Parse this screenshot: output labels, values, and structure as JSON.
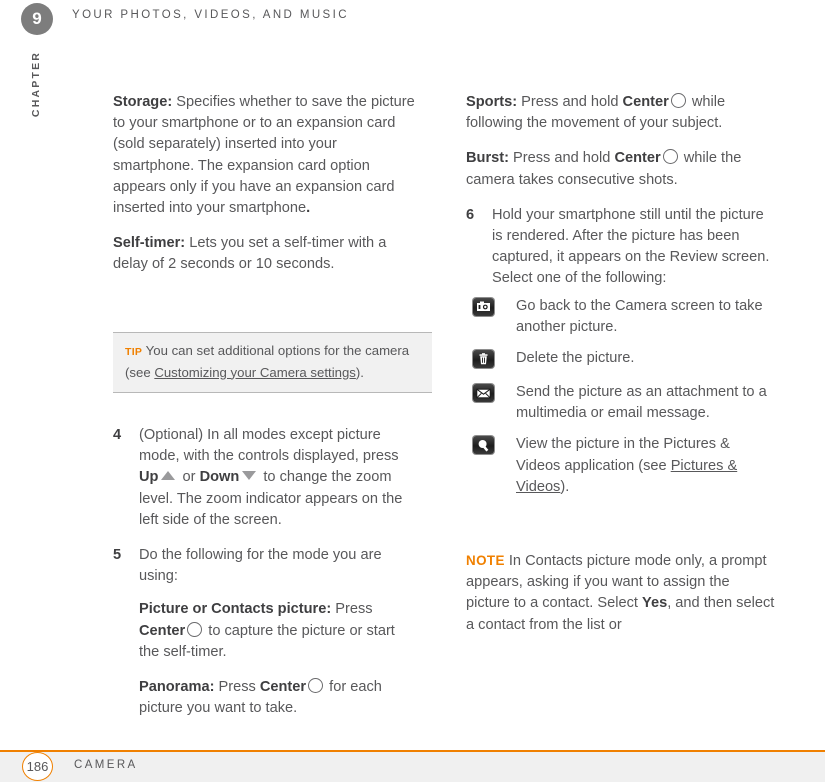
{
  "header": {
    "chapter_number": "9",
    "chapter_label": "CHAPTER",
    "title": "YOUR PHOTOS, VIDEOS, AND MUSIC"
  },
  "left_column": {
    "storage": {
      "term": "Storage:",
      "text": " Specifies whether to save the picture to your smartphone or to an expansion card (sold separately) inserted into your smartphone. The expansion card option appears only if you have an expansion card inserted into your smartphone",
      "tail": "."
    },
    "self_timer": {
      "term": "Self-timer:",
      "text": " Lets you set a self-timer with a delay of 2 seconds or 10 seconds."
    },
    "tip": {
      "label": "TIP",
      "text_before": " You can set additional options for the camera (see ",
      "link": "Customizing your Camera settings",
      "text_after": ")."
    },
    "step4": {
      "number": "4",
      "part1": "(Optional) In all modes except picture mode, with the controls displayed, press ",
      "up_label": "Up",
      "mid": " or ",
      "down_label": "Down",
      "part2": " to change the zoom level. The zoom indicator appears on the left side of the screen."
    },
    "step5": {
      "number": "5",
      "text": "Do the following for the mode you are using:",
      "picture_mode": {
        "term": "Picture or Contacts picture:",
        "part1": " Press ",
        "center_label": "Center",
        "part2": " to capture the picture or start the self-timer."
      },
      "panorama": {
        "term": "Panorama:",
        "part1": " Press ",
        "center_label": "Center",
        "part2": " for each picture you want to take."
      }
    }
  },
  "right_column": {
    "sports": {
      "term": "Sports:",
      "part1": " Press and hold ",
      "center_label": "Center",
      "part2": " while following the movement of your subject."
    },
    "burst": {
      "term": "Burst:",
      "part1": " Press and hold ",
      "center_label": "Center",
      "part2": " while the camera takes consecutive shots."
    },
    "step6": {
      "number": "6",
      "text": "Hold your smartphone still until the picture is rendered. After the picture has been captured, it appears on the Review screen. Select one of the following:",
      "options": [
        {
          "icon": "camera-icon",
          "text": "Go back to the Camera screen to take another picture."
        },
        {
          "icon": "trash-icon",
          "text": "Delete the picture."
        },
        {
          "icon": "envelope-icon",
          "text": "Send the picture as an attachment to a multimedia or email message."
        },
        {
          "icon": "magnifier-icon",
          "text_before": "View the picture in the Pictures & Videos application (see ",
          "link": "Pictures & Videos",
          "text_after": ")."
        }
      ]
    },
    "note": {
      "label": "NOTE",
      "part1": " In Contacts picture mode only, a prompt appears, asking if you want to assign the picture to a contact. Select ",
      "yes_label": "Yes",
      "part2": ", and then select a contact from the list or"
    }
  },
  "footer": {
    "page_number": "186",
    "section_title": "CAMERA"
  },
  "colors": {
    "accent_orange": "#f08000",
    "body_gray": "#58585a",
    "badge_gray": "#7d7d7d",
    "tip_background": "#f1f1f1"
  }
}
